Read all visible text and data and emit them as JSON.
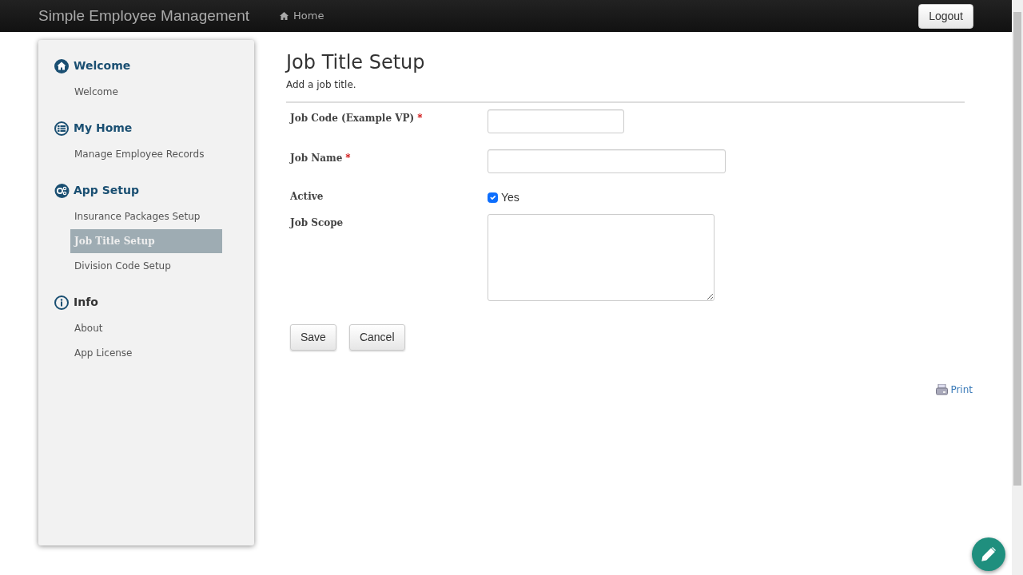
{
  "navbar": {
    "brand": "Simple Employee Management",
    "home_link": "Home",
    "logout_button": "Logout"
  },
  "sidebar": {
    "sections": [
      {
        "title": "Welcome",
        "items": [
          {
            "label": "Welcome",
            "selected": false
          }
        ]
      },
      {
        "title": "My Home",
        "items": [
          {
            "label": "Manage Employee Records",
            "selected": false
          }
        ]
      },
      {
        "title": "App Setup",
        "items": [
          {
            "label": "Insurance Packages Setup",
            "selected": false
          },
          {
            "label": "Job Title Setup",
            "selected": true
          },
          {
            "label": "Division Code Setup",
            "selected": false
          }
        ]
      },
      {
        "title": "Info",
        "items": [
          {
            "label": "About",
            "selected": false
          },
          {
            "label": "App License",
            "selected": false
          }
        ]
      }
    ]
  },
  "page": {
    "title": "Job Title Setup",
    "subtitle": "Add a job title.",
    "fields": [
      {
        "kind": "text",
        "label": "Job Code (Example VP)",
        "required_mark": "*"
      },
      {
        "kind": "text",
        "label": "Job Name",
        "required_mark": "*"
      },
      {
        "kind": "checkbox",
        "label": "Active",
        "checked": true,
        "option": "Yes"
      },
      {
        "kind": "textarea",
        "label": "Job Scope"
      }
    ],
    "buttons": [
      "Save",
      "Cancel"
    ],
    "print_link": "Print"
  }
}
